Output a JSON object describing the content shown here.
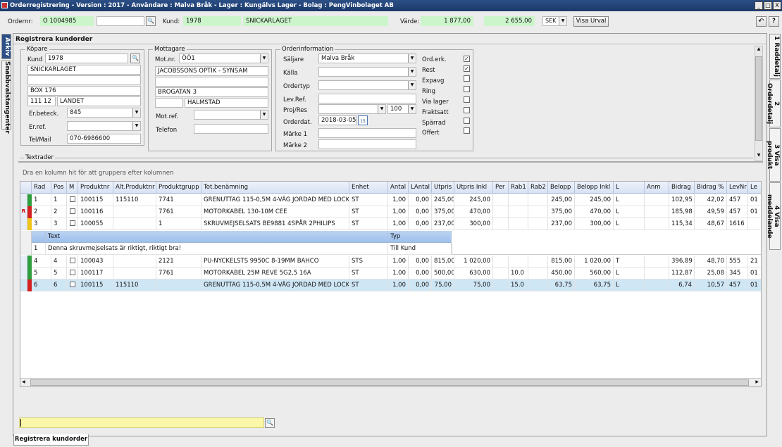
{
  "window": {
    "title": "Orderregistrering - Version : 2017 - Användare : Malva Bråk - Lager : Kungälvs Lager - Bolag : PengVinbolaget AB",
    "minimize": "_",
    "maximize": "□",
    "close": "X"
  },
  "topbar": {
    "ordernr_label": "Ordernr:",
    "ordernr_value": "O  1004985",
    "kund_label": "Kund:",
    "kund_nr": "1978",
    "kund_namn": "SNICKARLAGET",
    "varde_label": "Värde:",
    "varde_exkl": "1 877,00",
    "varde_inkl": "2 655,00",
    "currency": "SEK",
    "visa_urval": "Visa Urval",
    "undo": "↶",
    "help": "?"
  },
  "left_tabs": {
    "arkiv": "Arkiv",
    "snabbval": "Snabbvalstangenter"
  },
  "panel_title": "Registrera kundorder",
  "kopare": {
    "title": "Köpare",
    "kund_label": "Kund",
    "kund_value": "1978",
    "name": "SNICKARLAGET",
    "address1": "",
    "address2": "BOX 176",
    "postnr": "111 12",
    "ort": "LANDET",
    "erbeteck_label": "Er.beteck.",
    "erbeteck_value": "845",
    "erref_label": "Er.ref.",
    "erref_value": "",
    "telmail_label": "Tel/Mail",
    "telmail_value": "070-6986600"
  },
  "mottagare": {
    "title": "Mottagare",
    "motnr_label": "Mot.nr.",
    "motnr_value": "ÖÖ1",
    "name": "JACOBSSONS OPTIK - SYNSAM",
    "address1": "",
    "address2": "BROGATAN 3",
    "postnr": "",
    "ort": "HALMSTAD",
    "motref_label": "Mot.ref.",
    "telefon_label": "Telefon"
  },
  "orderinfo": {
    "title": "Orderinformation",
    "saljare_label": "Säljare",
    "saljare_value": "Malva Bråk",
    "kalla_label": "Källa",
    "ordertyp_label": "Ordertyp",
    "levref_label": "Lev.Ref.",
    "projres_label": "Proj/Res",
    "projres_pct": "100",
    "orderdat_label": "Orderdat.",
    "orderdat_value": "2018-03-05",
    "calendar_day": "15",
    "marke1_label": "Märke 1",
    "marke2_label": "Märke 2",
    "flags": [
      {
        "label": "Ord.erk.",
        "checked": true
      },
      {
        "label": "Rest",
        "checked": true
      },
      {
        "label": "Expavg",
        "checked": false
      },
      {
        "label": "Ring",
        "checked": false
      },
      {
        "label": "Via lager",
        "checked": false
      },
      {
        "label": "Fraktsatt",
        "checked": false
      },
      {
        "label": "Spärrad",
        "checked": false
      },
      {
        "label": "Offert",
        "checked": false
      }
    ]
  },
  "textrader_label": "Textrader",
  "group_hint": "Dra en kolumn hit för att gruppera efter kolumnen",
  "grid": {
    "columns": [
      "Rad",
      "Pos",
      "M",
      "Produktnr",
      "Alt.Produktnr",
      "Produktgrupp",
      "Tot.benämning",
      "Enhet",
      "Antal",
      "LAntal",
      "Utpris",
      "Utpris Inkl",
      "Per",
      "Rab1",
      "Rab2",
      "Belopp",
      "Belopp Inkl",
      "L",
      "Anm",
      "Bidrag",
      "Bidrag %",
      "LevNr",
      "Le"
    ],
    "rows": [
      [
        "1",
        "1",
        "",
        "100115",
        "115110",
        "7741",
        "GRENUTTAG 115-0,5M 4-VÄG JORDAD MED LOCK",
        "ST",
        "1,00",
        "0,00",
        "245,00",
        "245,00",
        "",
        "",
        "",
        "245,00",
        "245,00",
        "L",
        "",
        "102,95",
        "42,02",
        "457",
        "01"
      ],
      [
        "2",
        "2",
        "",
        "100116",
        "",
        "7761",
        "MOTORKABEL 130-10M CEE",
        "ST",
        "1,00",
        "0,00",
        "375,00",
        "470,00",
        "",
        "",
        "",
        "375,00",
        "470,00",
        "L",
        "",
        "185,98",
        "49,59",
        "457",
        "01"
      ],
      [
        "3",
        "3",
        "",
        "100055",
        "",
        "1",
        "SKRUVMEJSELSATS BE9881 4SPÅR 2PHILIPS",
        "ST",
        "1,00",
        "0,00",
        "237,00",
        "300,00",
        "",
        "",
        "",
        "237,00",
        "300,00",
        "L",
        "",
        "115,34",
        "48,67",
        "1616",
        ""
      ],
      [
        "4",
        "4",
        "",
        "100043",
        "",
        "2121",
        "PU-NYCKELSTS 9950C 8-19MM BAHCO",
        "STS",
        "1,00",
        "0,00",
        "815,00",
        "1 020,00",
        "",
        "",
        "",
        "815,00",
        "1 020,00",
        "T",
        "",
        "396,89",
        "48,70",
        "555",
        "21"
      ],
      [
        "5",
        "5",
        "",
        "100117",
        "",
        "7761",
        "MOTORKABEL 25M REVE 5G2,5 16A",
        "ST",
        "1,00",
        "0,00",
        "500,00",
        "630,00",
        "",
        "10.0",
        "",
        "450,00",
        "560,00",
        "L",
        "",
        "112,87",
        "25,08",
        "345",
        "01"
      ],
      [
        "6",
        "6",
        "",
        "100115",
        "115110",
        "",
        "GRENUTTAG 115-0,5M 4-VÄG JORDAD MED LOCK",
        "ST",
        "1,00",
        "0,00",
        "75,00",
        "75,00",
        "",
        "15.0",
        "",
        "63,75",
        "63,75",
        "L",
        "",
        "6,74",
        "10,57",
        "457",
        "01"
      ]
    ],
    "row_markers": [
      "",
      "R",
      "",
      "",
      "",
      ""
    ],
    "subgrid": {
      "columns": [
        "Text",
        "Typ"
      ],
      "row_index": "1",
      "text": "Denna skruvmejselsats är riktigt, riktigt bra!",
      "typ": "Till Kund"
    }
  },
  "right_tabs": [
    "1 Raddetalj",
    "2 Orderdetalj",
    "3 Visa produkt",
    "4 Visa meddelande"
  ],
  "search_value": "",
  "bottom_tab": "Registrera kundorder",
  "colors": {
    "green": "#ccf5cc",
    "yellow": "#fbf7a8",
    "selected_row": "#cfe6f5",
    "bar_green": "#2e9e3e",
    "bar_yellow": "#f0c419",
    "bar_red": "#d42020"
  }
}
